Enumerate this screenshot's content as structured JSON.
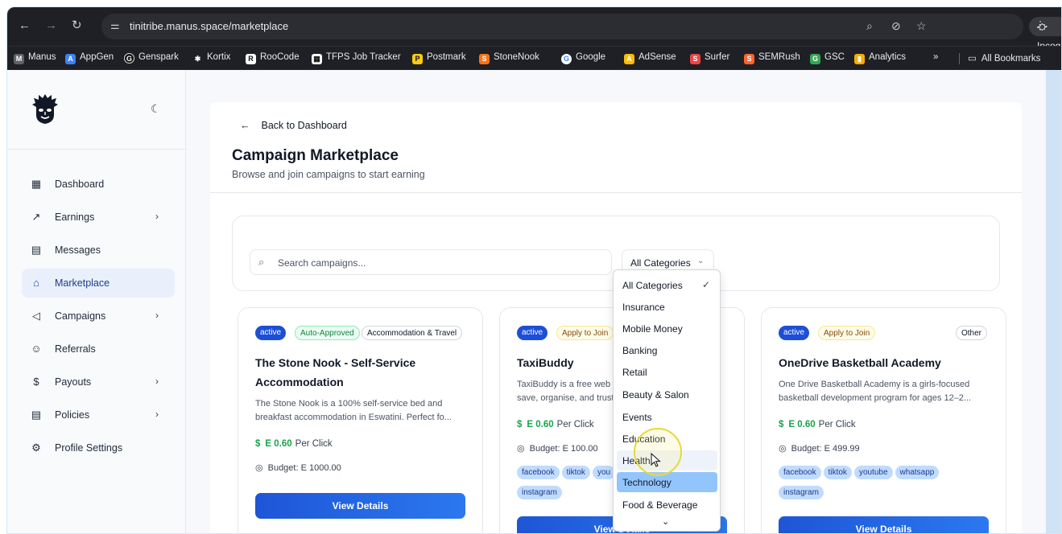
{
  "browser": {
    "url": "tinitribe.manus.space/marketplace",
    "incognito_label": "Incognito",
    "bookmarks": [
      "Manus",
      "AppGen",
      "Genspark",
      "Kortix",
      "RooCode",
      "TFPS Job Tracker",
      "Postmark",
      "StoneNook",
      "Google",
      "AdSense",
      "Surfer",
      "SEMRush",
      "GSC",
      "Analytics"
    ],
    "more": "»",
    "all_bookmarks": "All Bookmarks"
  },
  "sidebar": {
    "items": [
      {
        "label": "Dashboard"
      },
      {
        "label": "Earnings"
      },
      {
        "label": "Messages"
      },
      {
        "label": "Marketplace"
      },
      {
        "label": "Campaigns"
      },
      {
        "label": "Referrals"
      },
      {
        "label": "Payouts"
      },
      {
        "label": "Policies"
      },
      {
        "label": "Profile Settings"
      }
    ]
  },
  "header": {
    "back": "Back to Dashboard",
    "title": "Campaign Marketplace",
    "subtitle": "Browse and join campaigns to start earning"
  },
  "filters": {
    "search_placeholder": "Search campaigns...",
    "category_selected": "All Categories"
  },
  "dropdown": {
    "options": [
      "All Categories",
      "Insurance",
      "Mobile Money",
      "Banking",
      "Retail",
      "Beauty & Salon",
      "Events",
      "Education",
      "Health",
      "Technology",
      "Food & Beverage"
    ]
  },
  "campaigns": [
    {
      "status": "active",
      "join_type": "Auto-Approved",
      "category": "Accommodation & Travel",
      "title": "The Stone Nook - Self-Service Accommodation",
      "description": "The Stone Nook is a 100% self-service bed and breakfast accommodation in Eswatini. Perfect fo...",
      "price": "E 0.60",
      "price_unit": "Per Click",
      "budget": "Budget: E 1000.00",
      "tags": [],
      "button": "View Details"
    },
    {
      "status": "active",
      "join_type": "Apply to Join",
      "category": "",
      "title": "TaxiBuddy",
      "description": "TaxiBuddy is a free web a... save, organise, and trust...",
      "price": "E 0.60",
      "price_unit": "Per Click",
      "budget": "Budget: E 100.00",
      "tags": [
        "facebook",
        "tiktok",
        "you",
        "instagram"
      ],
      "button": "View Details"
    },
    {
      "status": "active",
      "join_type": "Apply to Join",
      "category": "Other",
      "title": "OneDrive Basketball Academy",
      "description": "One Drive Basketball Academy is a girls-focused basketball development program for ages 12–2...",
      "price": "E 0.60",
      "price_unit": "Per Click",
      "budget": "Budget: E 499.99",
      "tags": [
        "facebook",
        "tiktok",
        "youtube",
        "whatsapp",
        "instagram"
      ],
      "button": "View Details"
    }
  ],
  "colors": {
    "primary": "#1d4ed8",
    "money_green": "#16a34a",
    "tag_bg": "#bfdbfe"
  }
}
